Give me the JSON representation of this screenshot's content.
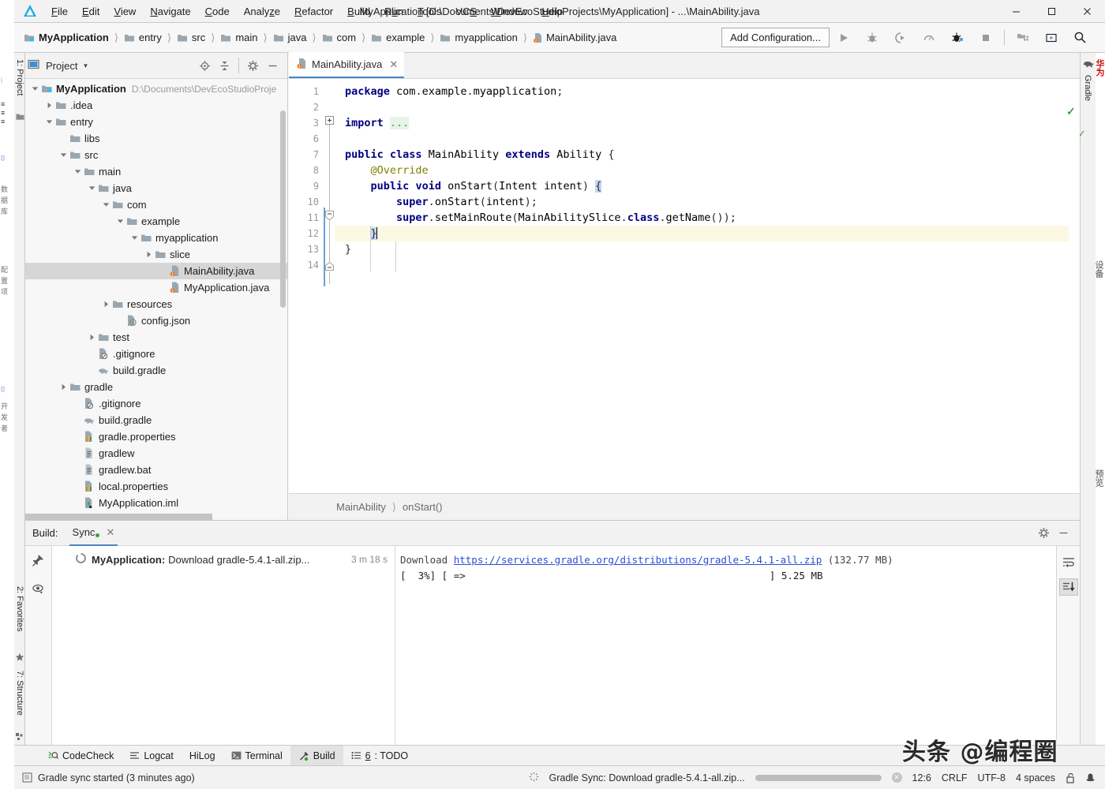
{
  "window": {
    "title": "MyApplication [D:\\Documents\\DevEcoStudioProjects\\MyApplication] - ...\\MainAbility.java",
    "minimize": "─",
    "maximize": "☐",
    "close": "✕"
  },
  "menu": [
    {
      "label": "File",
      "mnemonic": "F"
    },
    {
      "label": "Edit",
      "mnemonic": "E"
    },
    {
      "label": "View",
      "mnemonic": "V"
    },
    {
      "label": "Navigate",
      "mnemonic": "N"
    },
    {
      "label": "Code",
      "mnemonic": "C"
    },
    {
      "label": "Analyze",
      "mnemonic": "z"
    },
    {
      "label": "Refactor",
      "mnemonic": "R"
    },
    {
      "label": "Build",
      "mnemonic": "B"
    },
    {
      "label": "Run",
      "mnemonic": "u"
    },
    {
      "label": "Tools",
      "mnemonic": "T"
    },
    {
      "label": "VCS",
      "mnemonic": "S"
    },
    {
      "label": "Window",
      "mnemonic": "W"
    },
    {
      "label": "Help",
      "mnemonic": "H"
    }
  ],
  "breadcrumb": [
    {
      "label": "MyApplication",
      "icon": "module-icon",
      "bold": true
    },
    {
      "label": "entry",
      "icon": "folder-icon",
      "bold": false
    },
    {
      "label": "src",
      "icon": "folder-icon",
      "bold": false
    },
    {
      "label": "main",
      "icon": "folder-icon",
      "bold": false
    },
    {
      "label": "java",
      "icon": "folder-icon",
      "bold": false
    },
    {
      "label": "com",
      "icon": "folder-icon",
      "bold": false
    },
    {
      "label": "example",
      "icon": "folder-icon",
      "bold": false
    },
    {
      "label": "myapplication",
      "icon": "folder-icon",
      "bold": false
    },
    {
      "label": "MainAbility.java",
      "icon": "java-file-icon",
      "bold": false
    }
  ],
  "toolbar": {
    "add_configuration": "Add Configuration...",
    "buttons": [
      "run-icon",
      "debug-icon",
      "run-with-coverage-icon",
      "profiler-icon",
      "attach-debugger-icon",
      "stop-icon",
      "device-manager-icon",
      "device-preview-icon",
      "search-everywhere-icon"
    ]
  },
  "left_tool_tabs": [
    {
      "label": "1: Project",
      "icon": "project-icon"
    },
    {
      "label": "2: Favorites",
      "icon": "star-icon"
    },
    {
      "label": "7: Structure",
      "icon": "structure-icon"
    }
  ],
  "right_tool_tabs": [
    {
      "label": "Gradle",
      "icon": "gradle-elephant-icon"
    }
  ],
  "project_panel": {
    "title": "Project",
    "header_buttons": [
      "select-opened-file-icon",
      "collapse-all-icon",
      "settings-gear-icon",
      "hide-icon"
    ],
    "tree": [
      {
        "label": "MyApplication",
        "suffix": "D:\\Documents\\DevEcoStudioProje",
        "depth": 0,
        "arrow": "down",
        "icon": "module-icon",
        "bold": true,
        "selected": false
      },
      {
        "label": ".idea",
        "suffix": "",
        "depth": 1,
        "arrow": "right",
        "icon": "folder-icon",
        "bold": false,
        "selected": false
      },
      {
        "label": "entry",
        "suffix": "",
        "depth": 1,
        "arrow": "down",
        "icon": "folder-icon",
        "bold": false,
        "selected": false
      },
      {
        "label": "libs",
        "suffix": "",
        "depth": 2,
        "arrow": "none",
        "icon": "folder-icon",
        "bold": false,
        "selected": false
      },
      {
        "label": "src",
        "suffix": "",
        "depth": 2,
        "arrow": "down",
        "icon": "folder-icon",
        "bold": false,
        "selected": false
      },
      {
        "label": "main",
        "suffix": "",
        "depth": 3,
        "arrow": "down",
        "icon": "folder-icon",
        "bold": false,
        "selected": false
      },
      {
        "label": "java",
        "suffix": "",
        "depth": 4,
        "arrow": "down",
        "icon": "folder-icon",
        "bold": false,
        "selected": false
      },
      {
        "label": "com",
        "suffix": "",
        "depth": 5,
        "arrow": "down",
        "icon": "folder-icon",
        "bold": false,
        "selected": false
      },
      {
        "label": "example",
        "suffix": "",
        "depth": 6,
        "arrow": "down",
        "icon": "folder-icon",
        "bold": false,
        "selected": false
      },
      {
        "label": "myapplication",
        "suffix": "",
        "depth": 7,
        "arrow": "down",
        "icon": "folder-icon",
        "bold": false,
        "selected": false
      },
      {
        "label": "slice",
        "suffix": "",
        "depth": 8,
        "arrow": "right",
        "icon": "folder-icon",
        "bold": false,
        "selected": false
      },
      {
        "label": "MainAbility.java",
        "suffix": "",
        "depth": 9,
        "arrow": "none",
        "icon": "java-file-icon",
        "bold": false,
        "selected": true
      },
      {
        "label": "MyApplication.java",
        "suffix": "",
        "depth": 9,
        "arrow": "none",
        "icon": "java-file-icon",
        "bold": false,
        "selected": false
      },
      {
        "label": "resources",
        "suffix": "",
        "depth": 5,
        "arrow": "right",
        "icon": "folder-icon",
        "bold": false,
        "selected": false
      },
      {
        "label": "config.json",
        "suffix": "",
        "depth": 6,
        "arrow": "none",
        "icon": "json-file-icon",
        "bold": false,
        "selected": false
      },
      {
        "label": "test",
        "suffix": "",
        "depth": 4,
        "arrow": "right",
        "icon": "folder-icon",
        "bold": false,
        "selected": false
      },
      {
        "label": ".gitignore",
        "suffix": "",
        "depth": 4,
        "arrow": "none",
        "icon": "gitignore-file-icon",
        "bold": false,
        "selected": false
      },
      {
        "label": "build.gradle",
        "suffix": "",
        "depth": 4,
        "arrow": "none",
        "icon": "gradle-file-icon",
        "bold": false,
        "selected": false
      },
      {
        "label": "gradle",
        "suffix": "",
        "depth": 2,
        "arrow": "right",
        "icon": "folder-icon",
        "bold": false,
        "selected": false
      },
      {
        "label": ".gitignore",
        "suffix": "",
        "depth": 3,
        "arrow": "none",
        "icon": "gitignore-file-icon",
        "bold": false,
        "selected": false
      },
      {
        "label": "build.gradle",
        "suffix": "",
        "depth": 3,
        "arrow": "none",
        "icon": "gradle-file-icon",
        "bold": false,
        "selected": false
      },
      {
        "label": "gradle.properties",
        "suffix": "",
        "depth": 3,
        "arrow": "none",
        "icon": "properties-file-icon",
        "bold": false,
        "selected": false
      },
      {
        "label": "gradlew",
        "suffix": "",
        "depth": 3,
        "arrow": "none",
        "icon": "text-file-icon",
        "bold": false,
        "selected": false
      },
      {
        "label": "gradlew.bat",
        "suffix": "",
        "depth": 3,
        "arrow": "none",
        "icon": "text-file-icon",
        "bold": false,
        "selected": false
      },
      {
        "label": "local.properties",
        "suffix": "",
        "depth": 3,
        "arrow": "none",
        "icon": "properties-file-icon",
        "bold": false,
        "selected": false
      },
      {
        "label": "MyApplication.iml",
        "suffix": "",
        "depth": 3,
        "arrow": "none",
        "icon": "iml-file-icon",
        "bold": false,
        "selected": false
      }
    ]
  },
  "editor": {
    "tab": {
      "label": "MainAbility.java",
      "icon": "java-file-icon",
      "close": "✕"
    },
    "line_numbers": [
      "1",
      "2",
      "3",
      "6",
      "7",
      "8",
      "9",
      "10",
      "11",
      "12",
      "13",
      "14"
    ],
    "lines": [
      {
        "n": "1",
        "text": "package com.example.myapplication;",
        "highlight": false
      },
      {
        "n": "2",
        "text": "",
        "highlight": false
      },
      {
        "n": "3",
        "text": "import ...",
        "highlight": false
      },
      {
        "n": "6",
        "text": "",
        "highlight": false
      },
      {
        "n": "7",
        "text": "public class MainAbility extends Ability {",
        "highlight": false
      },
      {
        "n": "8",
        "text": "    @Override",
        "highlight": false
      },
      {
        "n": "9",
        "text": "    public void onStart(Intent intent) {",
        "highlight": false
      },
      {
        "n": "10",
        "text": "        super.onStart(intent);",
        "highlight": false
      },
      {
        "n": "11",
        "text": "        super.setMainRoute(MainAbilitySlice.class.getName());",
        "highlight": false
      },
      {
        "n": "12",
        "text": "    }",
        "highlight": true
      },
      {
        "n": "13",
        "text": "}",
        "highlight": false
      },
      {
        "n": "14",
        "text": "",
        "highlight": false
      }
    ],
    "breadcrumb": [
      "MainAbility",
      "onStart()"
    ],
    "inspection_status": "ok-check-icon"
  },
  "build_panel": {
    "label": "Build:",
    "tab": "Sync",
    "tab_close": "✕",
    "header_buttons": [
      "settings-gear-icon",
      "hide-icon"
    ],
    "side_icons": [
      "pin-icon",
      "eye-icon"
    ],
    "node": {
      "name": "MyApplication:",
      "task": "Download gradle-5.4.1-all.zip...",
      "duration": "3 m 18 s",
      "icon": "spinner-icon"
    },
    "console": {
      "line1_prefix": "Download ",
      "line1_url": "https://services.gradle.org/distributions/gradle-5.4.1-all.zip",
      "line1_size": " (132.77 MB)",
      "line2_left": "[  3%] [ =>",
      "line2_right": "] 5.25 MB"
    },
    "right_buttons": [
      "soft-wrap-icon",
      "scroll-to-end-icon"
    ]
  },
  "bottom_tabs": [
    {
      "label": "CodeCheck",
      "icon": "codecheck-icon",
      "active": false,
      "prefix": ""
    },
    {
      "label": "Logcat",
      "icon": "logcat-icon",
      "active": false,
      "prefix": ""
    },
    {
      "label": "HiLog",
      "icon": "",
      "active": false,
      "prefix": ""
    },
    {
      "label": "Terminal",
      "icon": "terminal-icon",
      "active": false,
      "prefix": ""
    },
    {
      "label": "Build",
      "icon": "build-hammer-icon",
      "active": true,
      "prefix": ""
    },
    {
      "label": ": TODO",
      "icon": "todo-icon",
      "active": false,
      "prefix": "6"
    }
  ],
  "status_bar": {
    "icon": "notification-icon",
    "message": "Gradle sync started (3 minutes ago)",
    "task_icon": "spinner-icon",
    "task": "Gradle Sync: Download gradle-5.4.1-all.zip...",
    "cancel": "✕",
    "position": "12:6",
    "line_separator": "CRLF",
    "encoding": "UTF-8",
    "indent": "4 spaces",
    "lock_icon": "unlocked-icon",
    "inspection_icon": "inspection-hat-icon"
  },
  "watermark": "头条 @编程圈",
  "colors": {
    "accent": "#4a86c8",
    "keyword": "#000080",
    "link": "#2a4fd7",
    "highlight_line": "#fdf8e3",
    "selection": "#c0d6f0",
    "green_ok": "#3aa03a"
  }
}
